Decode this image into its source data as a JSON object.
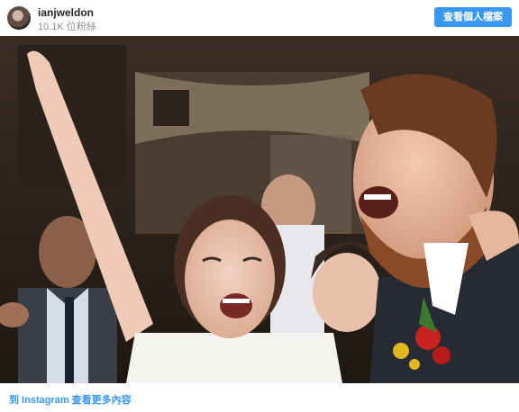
{
  "header": {
    "username": "ianjweldon",
    "followers": "10.1K 位粉絲",
    "follow_button": "查看個人檔案"
  },
  "photo": {
    "subject": "party photo"
  },
  "footer": {
    "link": "到 Instagram 查看更多內容"
  }
}
